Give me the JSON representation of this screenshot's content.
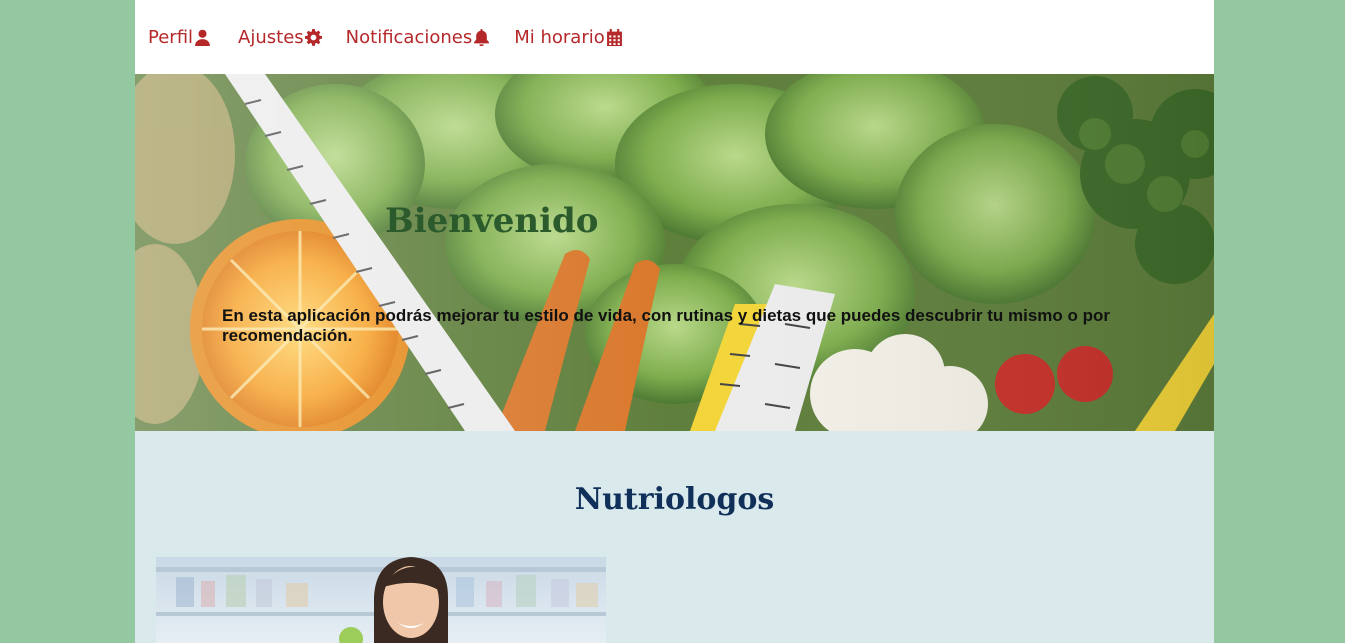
{
  "nav": {
    "items": [
      {
        "label": "Perfil",
        "icon": "user-icon"
      },
      {
        "label": "Ajustes",
        "icon": "gear-icon"
      },
      {
        "label": "Notificaciones",
        "icon": "bell-icon"
      },
      {
        "label": "Mi horario",
        "icon": "calendar-icon"
      }
    ]
  },
  "hero": {
    "title": "Bienvenido",
    "text": "En esta aplicación podrás mejorar tu estilo de vida, con rutinas y dietas que puedes descubrir tu mismo o por recomendación."
  },
  "section": {
    "title": "Nutriologos"
  },
  "colors": {
    "page_bg": "#93c8a0",
    "nav_accent": "#b5282a",
    "hero_title": "#2b5a2d",
    "section_title": "#10305a",
    "content_bg": "#d9e9ec"
  }
}
